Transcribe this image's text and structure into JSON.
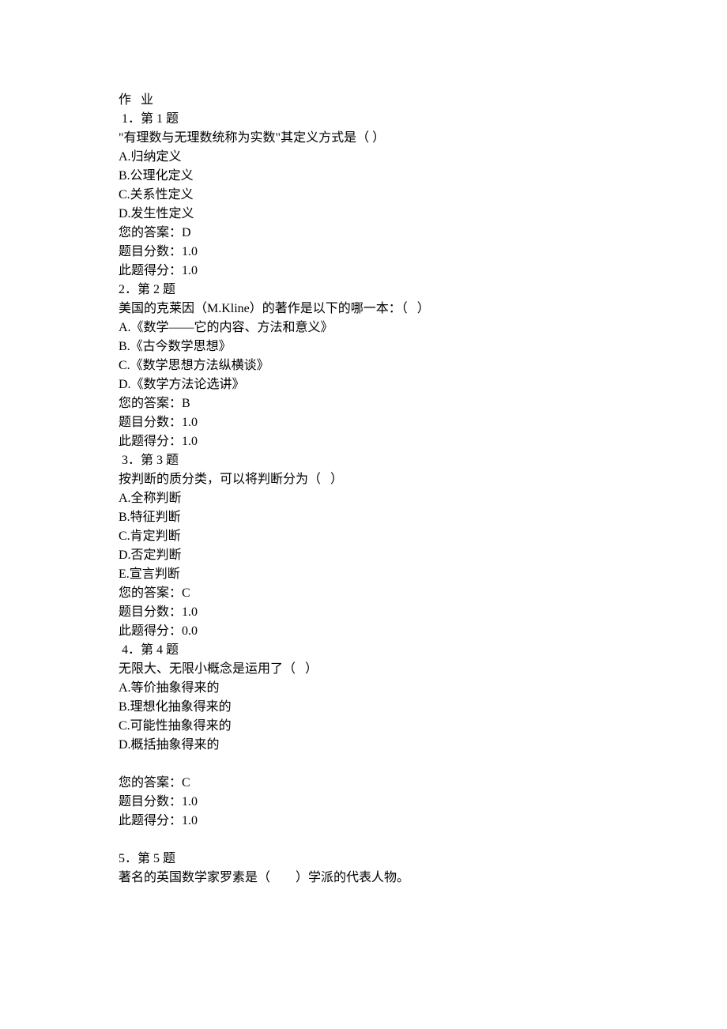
{
  "header": "作   业",
  "questions": [
    {
      "num_line": " 1．第 1 题",
      "prompt": "\"有理数与无理数统称为实数\"其定义方式是（ ）",
      "options": [
        "A.归纳定义",
        "B.公理化定义",
        "C.关系性定义",
        "D.发生性定义"
      ],
      "answer_line": "您的答案：D",
      "score_line": "题目分数：1.0",
      "got_line": "此题得分：1.0",
      "blank_before": false,
      "blank_after": false
    },
    {
      "num_line": "2．第 2 题",
      "prompt": "美国的克莱因（M.Kline）的著作是以下的哪一本：（   ）",
      "options": [
        "A.《数学——它的内容、方法和意义》",
        "B.《古今数学思想》",
        "C.《数学思想方法纵横谈》",
        "D.《数学方法论选讲》"
      ],
      "answer_line": "您的答案：B",
      "score_line": "题目分数：1.0",
      "got_line": "此题得分：1.0",
      "blank_before": false,
      "blank_after": false
    },
    {
      "num_line": " 3．第 3 题",
      "prompt": "按判断的质分类，可以将判断分为（   ）",
      "options": [
        "A.全称判断",
        "B.特征判断",
        "C.肯定判断",
        "D.否定判断",
        "E.宣言判断"
      ],
      "answer_line": "您的答案：C",
      "score_line": "题目分数：1.0",
      "got_line": "此题得分：0.0",
      "blank_before": false,
      "blank_after": false
    },
    {
      "num_line": " 4．第 4 题",
      "prompt": "无限大、无限小概念是运用了（   ）",
      "options": [
        "A.等价抽象得来的",
        "B.理想化抽象得来的",
        "C.可能性抽象得来的",
        "D.概括抽象得来的"
      ],
      "answer_line": "您的答案：C",
      "score_line": "题目分数：1.0",
      "got_line": "此题得分：1.0",
      "blank_before": true,
      "blank_after": true
    },
    {
      "num_line": "5．第 5 题",
      "prompt": "著名的英国数学家罗素是（        ）学派的代表人物。",
      "options": [],
      "answer_line": null,
      "score_line": null,
      "got_line": null,
      "blank_before": false,
      "blank_after": false
    }
  ]
}
